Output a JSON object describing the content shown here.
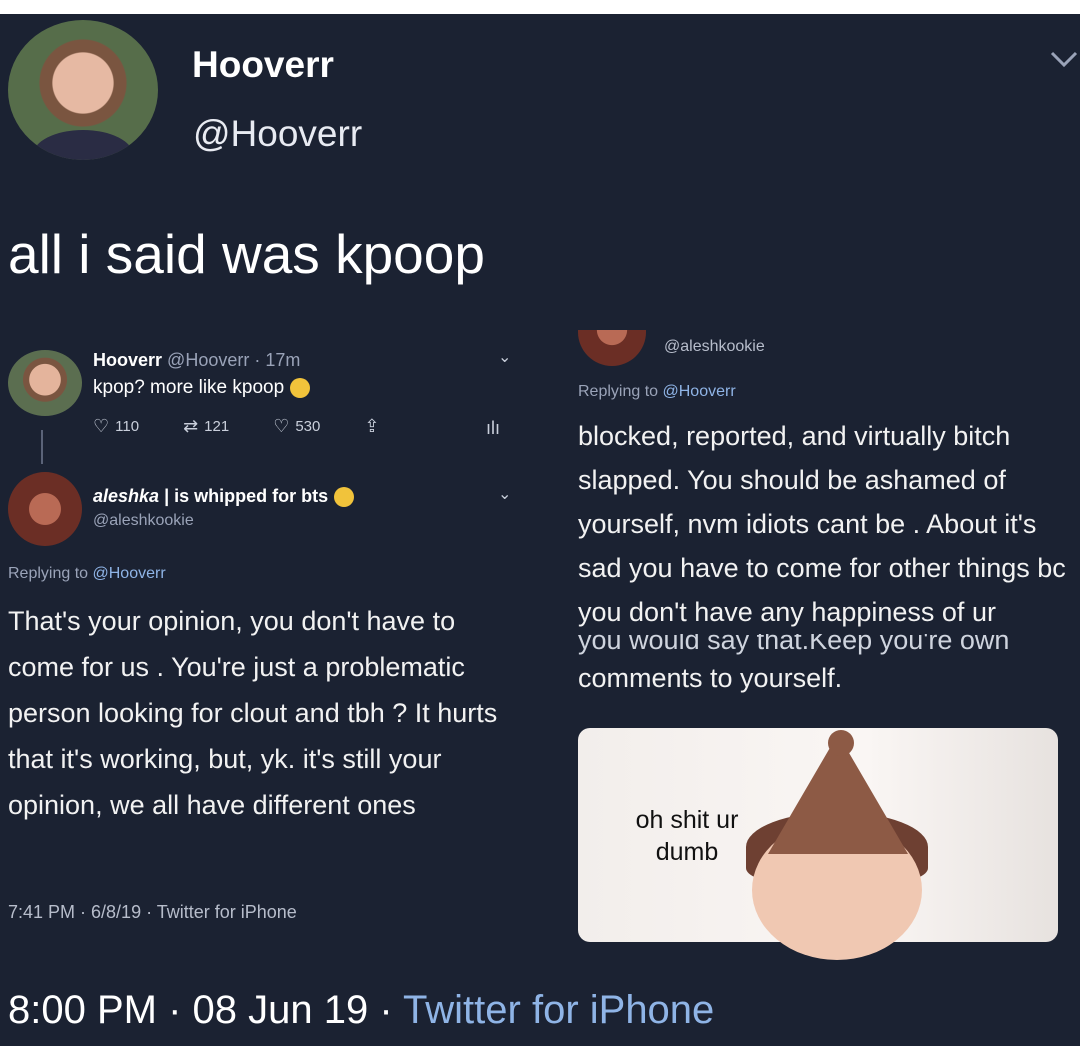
{
  "outer_tweet": {
    "name": "Hooverr",
    "handle": "@Hooverr",
    "text": "all i said was kpoop",
    "footer_time_date": "8:00 PM · 08 Jun 19 · ",
    "footer_source": "Twitter for iPhone"
  },
  "left_screenshot": {
    "tweet1": {
      "name": "Hooverr",
      "meta": "@Hooverr · 17m",
      "text": "kpop? more like kpoop",
      "replies": "110",
      "retweets": "121",
      "likes": "530"
    },
    "reply": {
      "name_styled": "aleshka",
      "name_rest": " | is whipped for bts",
      "handle": "@aleshkookie",
      "replying_prefix": "Replying to ",
      "replying_to": "@Hooverr",
      "text": "That's your opinion, you don't have to come for us . You're just a problematic person looking for clout and tbh ? It hurts that it's working, but, yk. it's still your opinion, we all have different ones",
      "timestamp": "7:41 PM · 6/8/19 · Twitter for iPhone"
    }
  },
  "right_screenshot": {
    "handle": "@aleshkookie",
    "replying_prefix": "Replying to ",
    "replying_to": "@Hooverr",
    "text_main": "blocked, reported, and virtually bitch slapped. You should be ashamed of yourself, nvm idiots cant be . About it's sad you have to come for other things bc you don't have any happiness of ur",
    "text_cut": "you would say that.Keep you're own",
    "text_end": "comments to yourself.",
    "meme_caption": "oh shit ur dumb"
  },
  "icons": {
    "reply": "comment-icon",
    "retweet": "retweet-icon",
    "like": "heart-icon",
    "share": "share-icon",
    "analytics": "analytics-icon",
    "chevron": "chevron-down-icon"
  }
}
